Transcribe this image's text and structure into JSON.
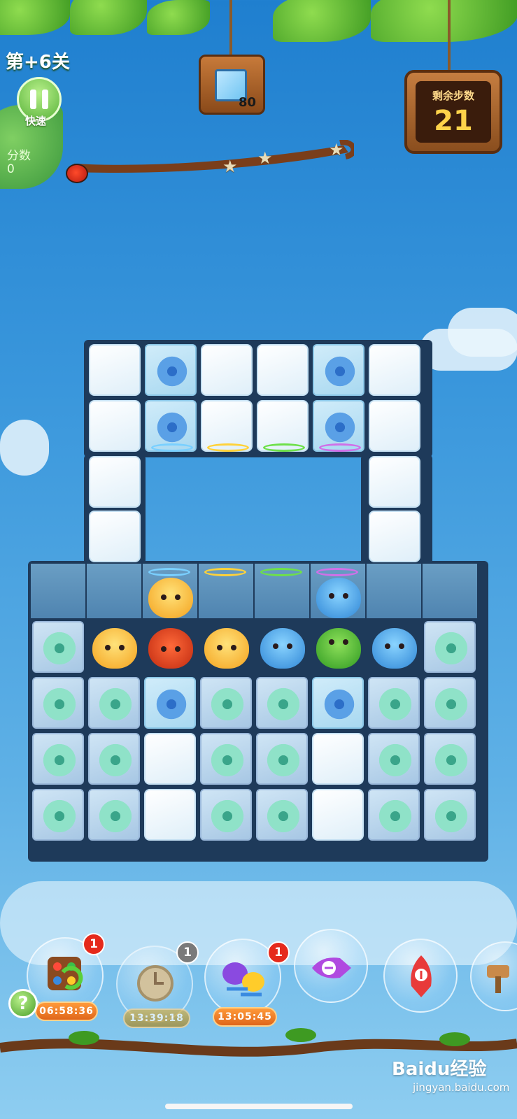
{
  "hud": {
    "level_label": "第+6关",
    "pause_label": "快速",
    "score_label": "分数",
    "score_value": "0",
    "goal_count": "80",
    "moves_title": "剩余步数",
    "moves_value": "21"
  },
  "boosters": [
    {
      "name": "shuffle",
      "badge": "1",
      "timer": "06:58:36",
      "badge_color": "#e52a1c"
    },
    {
      "name": "clock",
      "badge": "1",
      "timer": "13:39:18",
      "badge_color": "#7a7a7a"
    },
    {
      "name": "swap",
      "badge": "1",
      "timer": "13:05:45",
      "badge_color": "#e52a1c"
    },
    {
      "name": "horizontal-rocket",
      "badge": "",
      "timer": ""
    },
    {
      "name": "vertical-rocket",
      "badge": "",
      "timer": ""
    },
    {
      "name": "hammer",
      "badge": "",
      "timer": ""
    }
  ],
  "help_label": "?",
  "watermark": {
    "brand": "Baidu经验",
    "url": "jingyan.baidu.com"
  },
  "colors": {
    "accent": "#e52a1c",
    "timer": "#f08a2a",
    "sky": "#3a97dc"
  }
}
